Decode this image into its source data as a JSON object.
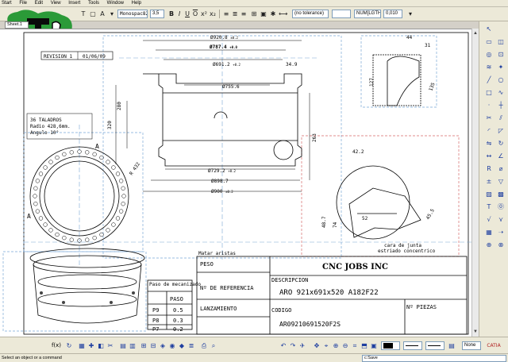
{
  "menu": {
    "items": [
      "Start",
      "File",
      "Edit",
      "View",
      "Insert",
      "Tools",
      "Window",
      "Help"
    ]
  },
  "toolbar": {
    "font_name": "Monospac821",
    "font_size": "3,5",
    "tolerance": "(no tolerance)",
    "number_format": "NUM[LGTH]",
    "precision": "0,010"
  },
  "sheet": {
    "tab_label": "Sheet.1"
  },
  "drawing": {
    "revision": "REVISION 1",
    "revision_date": "01/06/09",
    "note_lines": [
      "36 TALADROS",
      "Radio 428,6mm.",
      "Angulo 10°"
    ],
    "view_label_a": "A",
    "matar_aristas": "Matar aristas",
    "dimensions": {
      "d920": "Ø920.8",
      "d920_tol": "±0.2",
      "d787": "Ø787.4",
      "d787_tol": "+0.0",
      "d691": "Ø691.2",
      "d691_tol": "+0.2",
      "d755": "Ø755.6",
      "d729": "Ø729.2",
      "d729_tol": "+0.2",
      "d898": "Ø898.7",
      "d900": "Ø900",
      "d900_tol": "±0.2",
      "v280": "280",
      "v320": "320",
      "v263": "263",
      "v34_9": "34.9",
      "r432": "R 432",
      "v44": "44",
      "v31": "31",
      "v127": "127",
      "v135": "135",
      "v42_2": "42.2",
      "v48_7": "48.7",
      "v74": "74",
      "v52": "52",
      "v45_5": "45.5"
    },
    "callouts": {
      "cara_junta": "cara de junta",
      "estriado": "estriado concentrico"
    }
  },
  "title_block": {
    "company": "CNC JOBS INC",
    "peso_label": "PESO",
    "ref_label": "Nº DE REFERENCIA",
    "descripcion_label": "DESCRIPCION",
    "descripcion": "ARO 921x691x520 A182F22",
    "lanzamiento_label": "LANZAMIENTO",
    "codigo_label": "CODIGO",
    "codigo": "AR09210691520F2S",
    "piezas_label": "Nº PIEZAS",
    "paso_title": "Paso de mecanizado",
    "paso_header": "PASO",
    "paso_rows": [
      {
        "id": "P9",
        "value": "0.5"
      },
      {
        "id": "P8",
        "value": "0.3"
      },
      {
        "id": "P7",
        "value": "0.2"
      }
    ],
    "brand": "CATIA"
  },
  "bottombar": {
    "fx_label": "f(x)",
    "line_style": "None"
  },
  "status": {
    "message": "Select an object or a command",
    "command": "c:Save"
  },
  "colors": {
    "background": "#d4d0c8",
    "sheet": "#ffffff",
    "frame_blue": "#7aa7d6",
    "frame_red": "#d66a6a",
    "ink": "#000000",
    "logo_green": "#2b9a38"
  }
}
